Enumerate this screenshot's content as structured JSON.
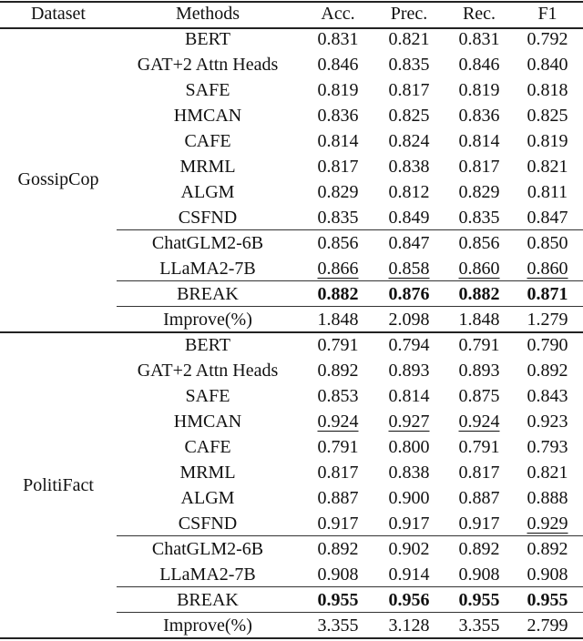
{
  "headers": [
    "Dataset",
    "Methods",
    "Acc.",
    "Prec.",
    "Rec.",
    "F1"
  ],
  "groups": [
    {
      "dataset": "GossipCop",
      "rows": [
        {
          "method": "BERT",
          "values": [
            "0.831",
            "0.821",
            "0.831",
            "0.792"
          ],
          "bold": false,
          "underline": [
            false,
            false,
            false,
            false
          ]
        },
        {
          "method": "GAT+2 Attn Heads",
          "values": [
            "0.846",
            "0.835",
            "0.846",
            "0.840"
          ],
          "bold": false,
          "underline": [
            false,
            false,
            false,
            false
          ]
        },
        {
          "method": "SAFE",
          "values": [
            "0.819",
            "0.817",
            "0.819",
            "0.818"
          ],
          "bold": false,
          "underline": [
            false,
            false,
            false,
            false
          ]
        },
        {
          "method": "HMCAN",
          "values": [
            "0.836",
            "0.825",
            "0.836",
            "0.825"
          ],
          "bold": false,
          "underline": [
            false,
            false,
            false,
            false
          ]
        },
        {
          "method": "CAFE",
          "values": [
            "0.814",
            "0.824",
            "0.814",
            "0.819"
          ],
          "bold": false,
          "underline": [
            false,
            false,
            false,
            false
          ]
        },
        {
          "method": "MRML",
          "values": [
            "0.817",
            "0.838",
            "0.817",
            "0.821"
          ],
          "bold": false,
          "underline": [
            false,
            false,
            false,
            false
          ]
        },
        {
          "method": "ALGM",
          "values": [
            "0.829",
            "0.812",
            "0.829",
            "0.811"
          ],
          "bold": false,
          "underline": [
            false,
            false,
            false,
            false
          ]
        },
        {
          "method": "CSFND",
          "values": [
            "0.835",
            "0.849",
            "0.835",
            "0.847"
          ],
          "bold": false,
          "underline": [
            false,
            false,
            false,
            false
          ]
        },
        {
          "method": "ChatGLM2-6B",
          "values": [
            "0.856",
            "0.847",
            "0.856",
            "0.850"
          ],
          "bold": false,
          "underline": [
            false,
            false,
            false,
            false
          ]
        },
        {
          "method": "LLaMA2-7B",
          "values": [
            "0.866",
            "0.858",
            "0.860",
            "0.860"
          ],
          "bold": false,
          "underline": [
            true,
            true,
            true,
            true
          ]
        },
        {
          "method": "BREAK",
          "values": [
            "0.882",
            "0.876",
            "0.882",
            "0.871"
          ],
          "bold": true,
          "underline": [
            false,
            false,
            false,
            false
          ]
        },
        {
          "method": "Improve(%)",
          "values": [
            "1.848",
            "2.098",
            "1.848",
            "1.279"
          ],
          "bold": false,
          "underline": [
            false,
            false,
            false,
            false
          ]
        }
      ]
    },
    {
      "dataset": "PolitiFact",
      "rows": [
        {
          "method": "BERT",
          "values": [
            "0.791",
            "0.794",
            "0.791",
            "0.790"
          ],
          "bold": false,
          "underline": [
            false,
            false,
            false,
            false
          ]
        },
        {
          "method": "GAT+2 Attn Heads",
          "values": [
            "0.892",
            "0.893",
            "0.893",
            "0.892"
          ],
          "bold": false,
          "underline": [
            false,
            false,
            false,
            false
          ]
        },
        {
          "method": "SAFE",
          "values": [
            "0.853",
            "0.814",
            "0.875",
            "0.843"
          ],
          "bold": false,
          "underline": [
            false,
            false,
            false,
            false
          ]
        },
        {
          "method": "HMCAN",
          "values": [
            "0.924",
            "0.927",
            "0.924",
            "0.923"
          ],
          "bold": false,
          "underline": [
            true,
            true,
            true,
            false
          ]
        },
        {
          "method": "CAFE",
          "values": [
            "0.791",
            "0.800",
            "0.791",
            "0.793"
          ],
          "bold": false,
          "underline": [
            false,
            false,
            false,
            false
          ]
        },
        {
          "method": "MRML",
          "values": [
            "0.817",
            "0.838",
            "0.817",
            "0.821"
          ],
          "bold": false,
          "underline": [
            false,
            false,
            false,
            false
          ]
        },
        {
          "method": "ALGM",
          "values": [
            "0.887",
            "0.900",
            "0.887",
            "0.888"
          ],
          "bold": false,
          "underline": [
            false,
            false,
            false,
            false
          ]
        },
        {
          "method": "CSFND",
          "values": [
            "0.917",
            "0.917",
            "0.917",
            "0.929"
          ],
          "bold": false,
          "underline": [
            false,
            false,
            false,
            true
          ]
        },
        {
          "method": "ChatGLM2-6B",
          "values": [
            "0.892",
            "0.902",
            "0.892",
            "0.892"
          ],
          "bold": false,
          "underline": [
            false,
            false,
            false,
            false
          ]
        },
        {
          "method": "LLaMA2-7B",
          "values": [
            "0.908",
            "0.914",
            "0.908",
            "0.908"
          ],
          "bold": false,
          "underline": [
            false,
            false,
            false,
            false
          ]
        },
        {
          "method": "BREAK",
          "values": [
            "0.955",
            "0.956",
            "0.955",
            "0.955"
          ],
          "bold": true,
          "underline": [
            false,
            false,
            false,
            false
          ]
        },
        {
          "method": "Improve(%)",
          "values": [
            "3.355",
            "3.128",
            "3.355",
            "2.799"
          ],
          "bold": false,
          "underline": [
            false,
            false,
            false,
            false
          ]
        }
      ]
    }
  ]
}
